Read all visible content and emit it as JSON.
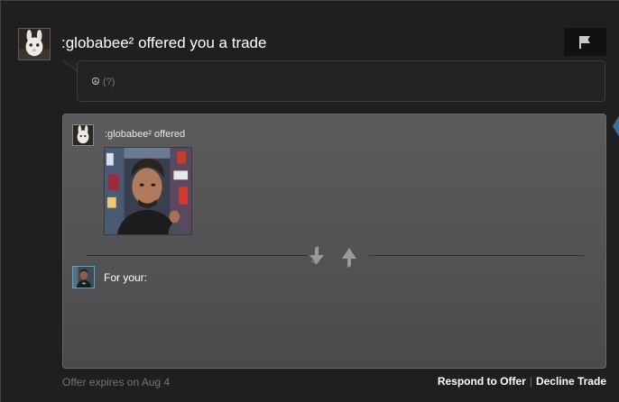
{
  "header": {
    "title": ":globabee² offered you a trade",
    "avatar_icon": "bunny-mask-avatar",
    "report_icon": "flag-icon"
  },
  "message": {
    "text": "☮",
    "help": "(?)"
  },
  "offer": {
    "them_label": ":globabee² offered",
    "item_image": "selfie-photo-item",
    "swap_icon": "swap-arrows-icon",
    "you_label": "For your:"
  },
  "footer": {
    "expires": "Offer expires on Aug 4",
    "respond": "Respond to Offer",
    "separator": "|",
    "decline": "Decline Trade"
  },
  "colors": {
    "page_bg": "#1f1f20",
    "panel_bg": "#565658",
    "you_avatar_border": "#57a8c9",
    "muted_text": "#747474"
  }
}
